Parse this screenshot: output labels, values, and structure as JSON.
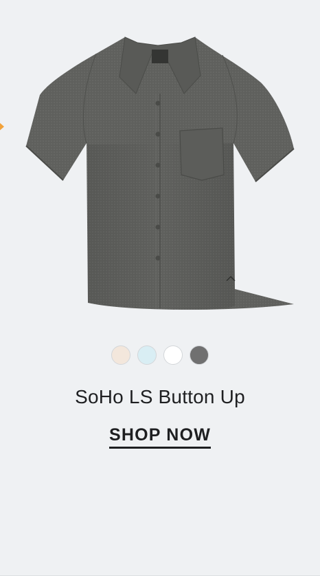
{
  "product": {
    "image_alt": "gray short sleeve button up shirt",
    "title": "SoHo LS Button Up",
    "cta_label": "SHOP NOW"
  },
  "swatches": [
    {
      "name": "cream",
      "color": "#f3e7dc"
    },
    {
      "name": "light-blue",
      "color": "#d9eef4"
    },
    {
      "name": "white",
      "color": "#ffffff"
    },
    {
      "name": "charcoal",
      "color": "#707070"
    }
  ],
  "colors": {
    "background": "#eff1f3",
    "shirt": "#5f605d",
    "text": "#1e1f21",
    "arrow": "#f2a23a"
  }
}
